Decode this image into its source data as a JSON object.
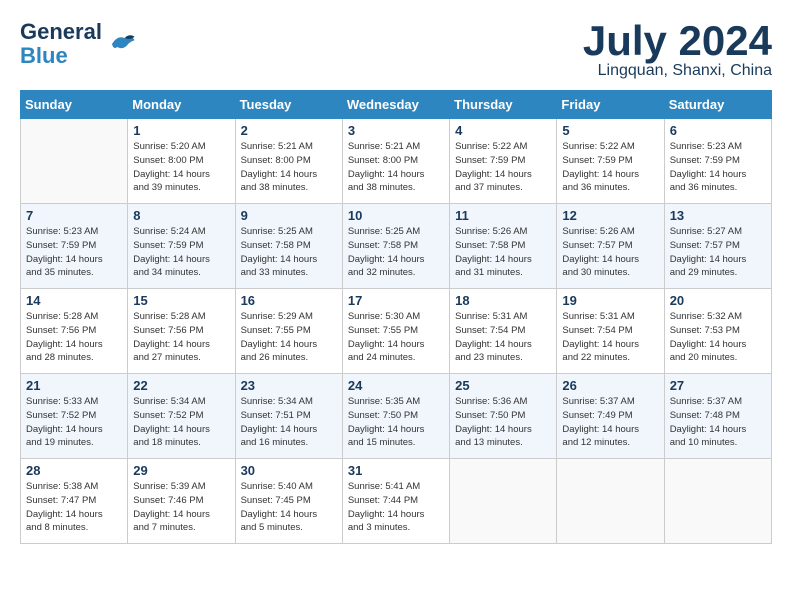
{
  "header": {
    "logo_line1": "General",
    "logo_line2": "Blue",
    "month_title": "July 2024",
    "location": "Lingquan, Shanxi, China"
  },
  "calendar": {
    "days_of_week": [
      "Sunday",
      "Monday",
      "Tuesday",
      "Wednesday",
      "Thursday",
      "Friday",
      "Saturday"
    ],
    "weeks": [
      [
        {
          "day": "",
          "info": ""
        },
        {
          "day": "1",
          "info": "Sunrise: 5:20 AM\nSunset: 8:00 PM\nDaylight: 14 hours\nand 39 minutes."
        },
        {
          "day": "2",
          "info": "Sunrise: 5:21 AM\nSunset: 8:00 PM\nDaylight: 14 hours\nand 38 minutes."
        },
        {
          "day": "3",
          "info": "Sunrise: 5:21 AM\nSunset: 8:00 PM\nDaylight: 14 hours\nand 38 minutes."
        },
        {
          "day": "4",
          "info": "Sunrise: 5:22 AM\nSunset: 7:59 PM\nDaylight: 14 hours\nand 37 minutes."
        },
        {
          "day": "5",
          "info": "Sunrise: 5:22 AM\nSunset: 7:59 PM\nDaylight: 14 hours\nand 36 minutes."
        },
        {
          "day": "6",
          "info": "Sunrise: 5:23 AM\nSunset: 7:59 PM\nDaylight: 14 hours\nand 36 minutes."
        }
      ],
      [
        {
          "day": "7",
          "info": "Sunrise: 5:23 AM\nSunset: 7:59 PM\nDaylight: 14 hours\nand 35 minutes."
        },
        {
          "day": "8",
          "info": "Sunrise: 5:24 AM\nSunset: 7:59 PM\nDaylight: 14 hours\nand 34 minutes."
        },
        {
          "day": "9",
          "info": "Sunrise: 5:25 AM\nSunset: 7:58 PM\nDaylight: 14 hours\nand 33 minutes."
        },
        {
          "day": "10",
          "info": "Sunrise: 5:25 AM\nSunset: 7:58 PM\nDaylight: 14 hours\nand 32 minutes."
        },
        {
          "day": "11",
          "info": "Sunrise: 5:26 AM\nSunset: 7:58 PM\nDaylight: 14 hours\nand 31 minutes."
        },
        {
          "day": "12",
          "info": "Sunrise: 5:26 AM\nSunset: 7:57 PM\nDaylight: 14 hours\nand 30 minutes."
        },
        {
          "day": "13",
          "info": "Sunrise: 5:27 AM\nSunset: 7:57 PM\nDaylight: 14 hours\nand 29 minutes."
        }
      ],
      [
        {
          "day": "14",
          "info": "Sunrise: 5:28 AM\nSunset: 7:56 PM\nDaylight: 14 hours\nand 28 minutes."
        },
        {
          "day": "15",
          "info": "Sunrise: 5:28 AM\nSunset: 7:56 PM\nDaylight: 14 hours\nand 27 minutes."
        },
        {
          "day": "16",
          "info": "Sunrise: 5:29 AM\nSunset: 7:55 PM\nDaylight: 14 hours\nand 26 minutes."
        },
        {
          "day": "17",
          "info": "Sunrise: 5:30 AM\nSunset: 7:55 PM\nDaylight: 14 hours\nand 24 minutes."
        },
        {
          "day": "18",
          "info": "Sunrise: 5:31 AM\nSunset: 7:54 PM\nDaylight: 14 hours\nand 23 minutes."
        },
        {
          "day": "19",
          "info": "Sunrise: 5:31 AM\nSunset: 7:54 PM\nDaylight: 14 hours\nand 22 minutes."
        },
        {
          "day": "20",
          "info": "Sunrise: 5:32 AM\nSunset: 7:53 PM\nDaylight: 14 hours\nand 20 minutes."
        }
      ],
      [
        {
          "day": "21",
          "info": "Sunrise: 5:33 AM\nSunset: 7:52 PM\nDaylight: 14 hours\nand 19 minutes."
        },
        {
          "day": "22",
          "info": "Sunrise: 5:34 AM\nSunset: 7:52 PM\nDaylight: 14 hours\nand 18 minutes."
        },
        {
          "day": "23",
          "info": "Sunrise: 5:34 AM\nSunset: 7:51 PM\nDaylight: 14 hours\nand 16 minutes."
        },
        {
          "day": "24",
          "info": "Sunrise: 5:35 AM\nSunset: 7:50 PM\nDaylight: 14 hours\nand 15 minutes."
        },
        {
          "day": "25",
          "info": "Sunrise: 5:36 AM\nSunset: 7:50 PM\nDaylight: 14 hours\nand 13 minutes."
        },
        {
          "day": "26",
          "info": "Sunrise: 5:37 AM\nSunset: 7:49 PM\nDaylight: 14 hours\nand 12 minutes."
        },
        {
          "day": "27",
          "info": "Sunrise: 5:37 AM\nSunset: 7:48 PM\nDaylight: 14 hours\nand 10 minutes."
        }
      ],
      [
        {
          "day": "28",
          "info": "Sunrise: 5:38 AM\nSunset: 7:47 PM\nDaylight: 14 hours\nand 8 minutes."
        },
        {
          "day": "29",
          "info": "Sunrise: 5:39 AM\nSunset: 7:46 PM\nDaylight: 14 hours\nand 7 minutes."
        },
        {
          "day": "30",
          "info": "Sunrise: 5:40 AM\nSunset: 7:45 PM\nDaylight: 14 hours\nand 5 minutes."
        },
        {
          "day": "31",
          "info": "Sunrise: 5:41 AM\nSunset: 7:44 PM\nDaylight: 14 hours\nand 3 minutes."
        },
        {
          "day": "",
          "info": ""
        },
        {
          "day": "",
          "info": ""
        },
        {
          "day": "",
          "info": ""
        }
      ]
    ]
  }
}
